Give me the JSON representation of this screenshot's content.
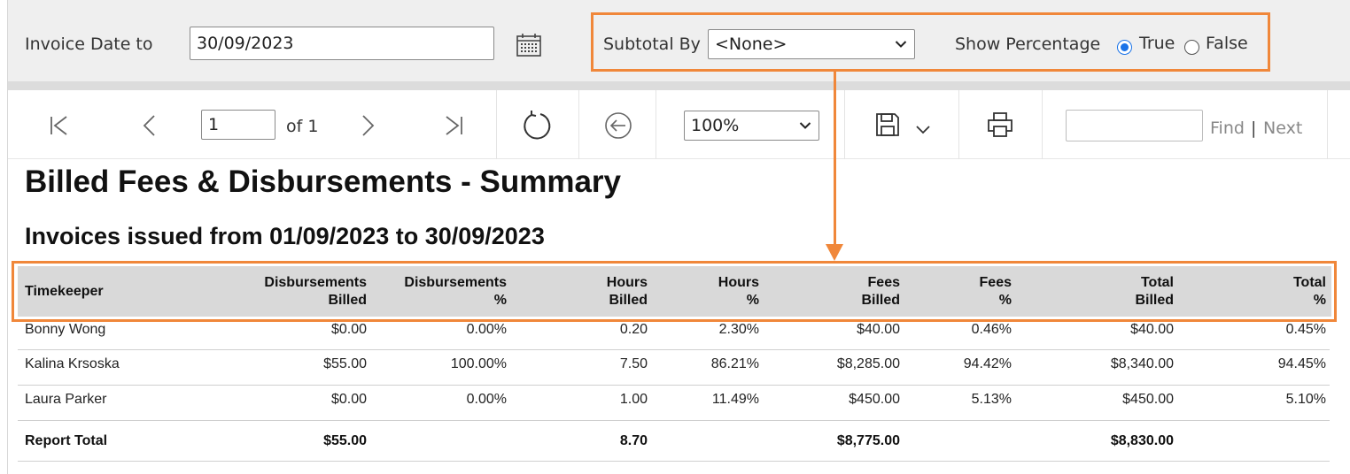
{
  "params": {
    "invoice_date_to_label": "Invoice Date to",
    "invoice_date_to_value": "30/09/2023",
    "subtotal_by_label": "Subtotal By",
    "subtotal_by_value": "<None>",
    "show_percentage_label": "Show Percentage",
    "show_percentage_options": [
      "True",
      "False"
    ],
    "show_percentage_selected": "True"
  },
  "toolbar": {
    "page_value": "1",
    "page_of": "of 1",
    "zoom": "100%",
    "find_label": "Find",
    "separator": "|",
    "next_label": "Next",
    "icons": [
      "first-page-icon",
      "previous-page-icon",
      "next-page-icon",
      "last-page-icon",
      "refresh-icon",
      "back-icon",
      "save-icon",
      "chevron-down-icon",
      "print-icon"
    ]
  },
  "report": {
    "title": "Billed Fees & Disbursements - Summary",
    "subtitle": "Invoices issued from 01/09/2023 to 30/09/2023",
    "columns": [
      {
        "line1": "Timekeeper",
        "line2": ""
      },
      {
        "line1": "Disbursements",
        "line2": "Billed"
      },
      {
        "line1": "Disbursements",
        "line2": "%"
      },
      {
        "line1": "Hours",
        "line2": "Billed"
      },
      {
        "line1": "Hours",
        "line2": "%"
      },
      {
        "line1": "Fees",
        "line2": "Billed"
      },
      {
        "line1": "Fees",
        "line2": "%"
      },
      {
        "line1": "Total",
        "line2": "Billed"
      },
      {
        "line1": "Total",
        "line2": "%"
      }
    ],
    "rows": [
      [
        "Bonny Wong",
        "$0.00",
        "0.00%",
        "0.20",
        "2.30%",
        "$40.00",
        "0.46%",
        "$40.00",
        "0.45%"
      ],
      [
        "Kalina Krsoska",
        "$55.00",
        "100.00%",
        "7.50",
        "86.21%",
        "$8,285.00",
        "94.42%",
        "$8,340.00",
        "94.45%"
      ],
      [
        "Laura Parker",
        "$0.00",
        "0.00%",
        "1.00",
        "11.49%",
        "$450.00",
        "5.13%",
        "$450.00",
        "5.10%"
      ]
    ],
    "total": [
      "Report Total",
      "$55.00",
      "",
      "8.70",
      "",
      "$8,775.00",
      "",
      "$8,830.00",
      ""
    ]
  },
  "colors": {
    "highlight": "#f0873a",
    "radio_selected": "#1a73e8",
    "header_bg": "#d9d9d9",
    "param_bg": "#efefef"
  }
}
